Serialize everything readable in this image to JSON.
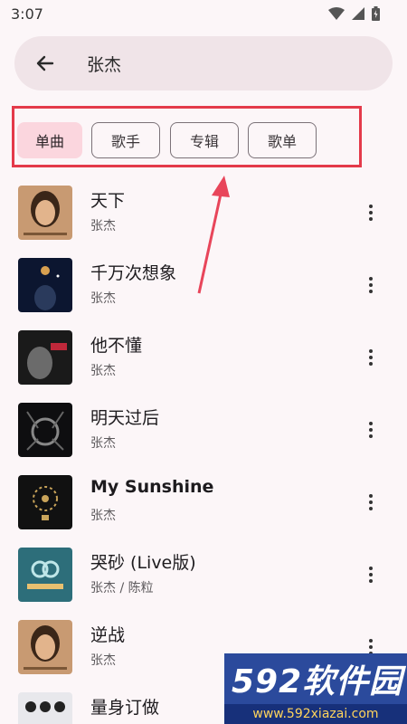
{
  "status_bar": {
    "time": "3:07"
  },
  "search": {
    "query": "张杰"
  },
  "filters": [
    {
      "label": "单曲",
      "selected": true
    },
    {
      "label": "歌手",
      "selected": false
    },
    {
      "label": "专辑",
      "selected": false
    },
    {
      "label": "歌单",
      "selected": false
    }
  ],
  "songs": [
    {
      "title": "天下",
      "artist": "张杰"
    },
    {
      "title": "千万次想象",
      "artist": "张杰"
    },
    {
      "title": "他不懂",
      "artist": "张杰"
    },
    {
      "title": "明天过后",
      "artist": "张杰"
    },
    {
      "title": "My Sunshine",
      "artist": "张杰"
    },
    {
      "title": "哭砂 (Live版)",
      "artist": "张杰 / 陈粒"
    },
    {
      "title": "逆战",
      "artist": "张杰"
    },
    {
      "title": "量身订做",
      "artist": ""
    }
  ],
  "watermark": {
    "logo": "592软件园",
    "url": "www.592xiazai.com"
  },
  "colors": {
    "accent_chip": "#fbd6de",
    "highlight_box": "#e43a4a"
  }
}
